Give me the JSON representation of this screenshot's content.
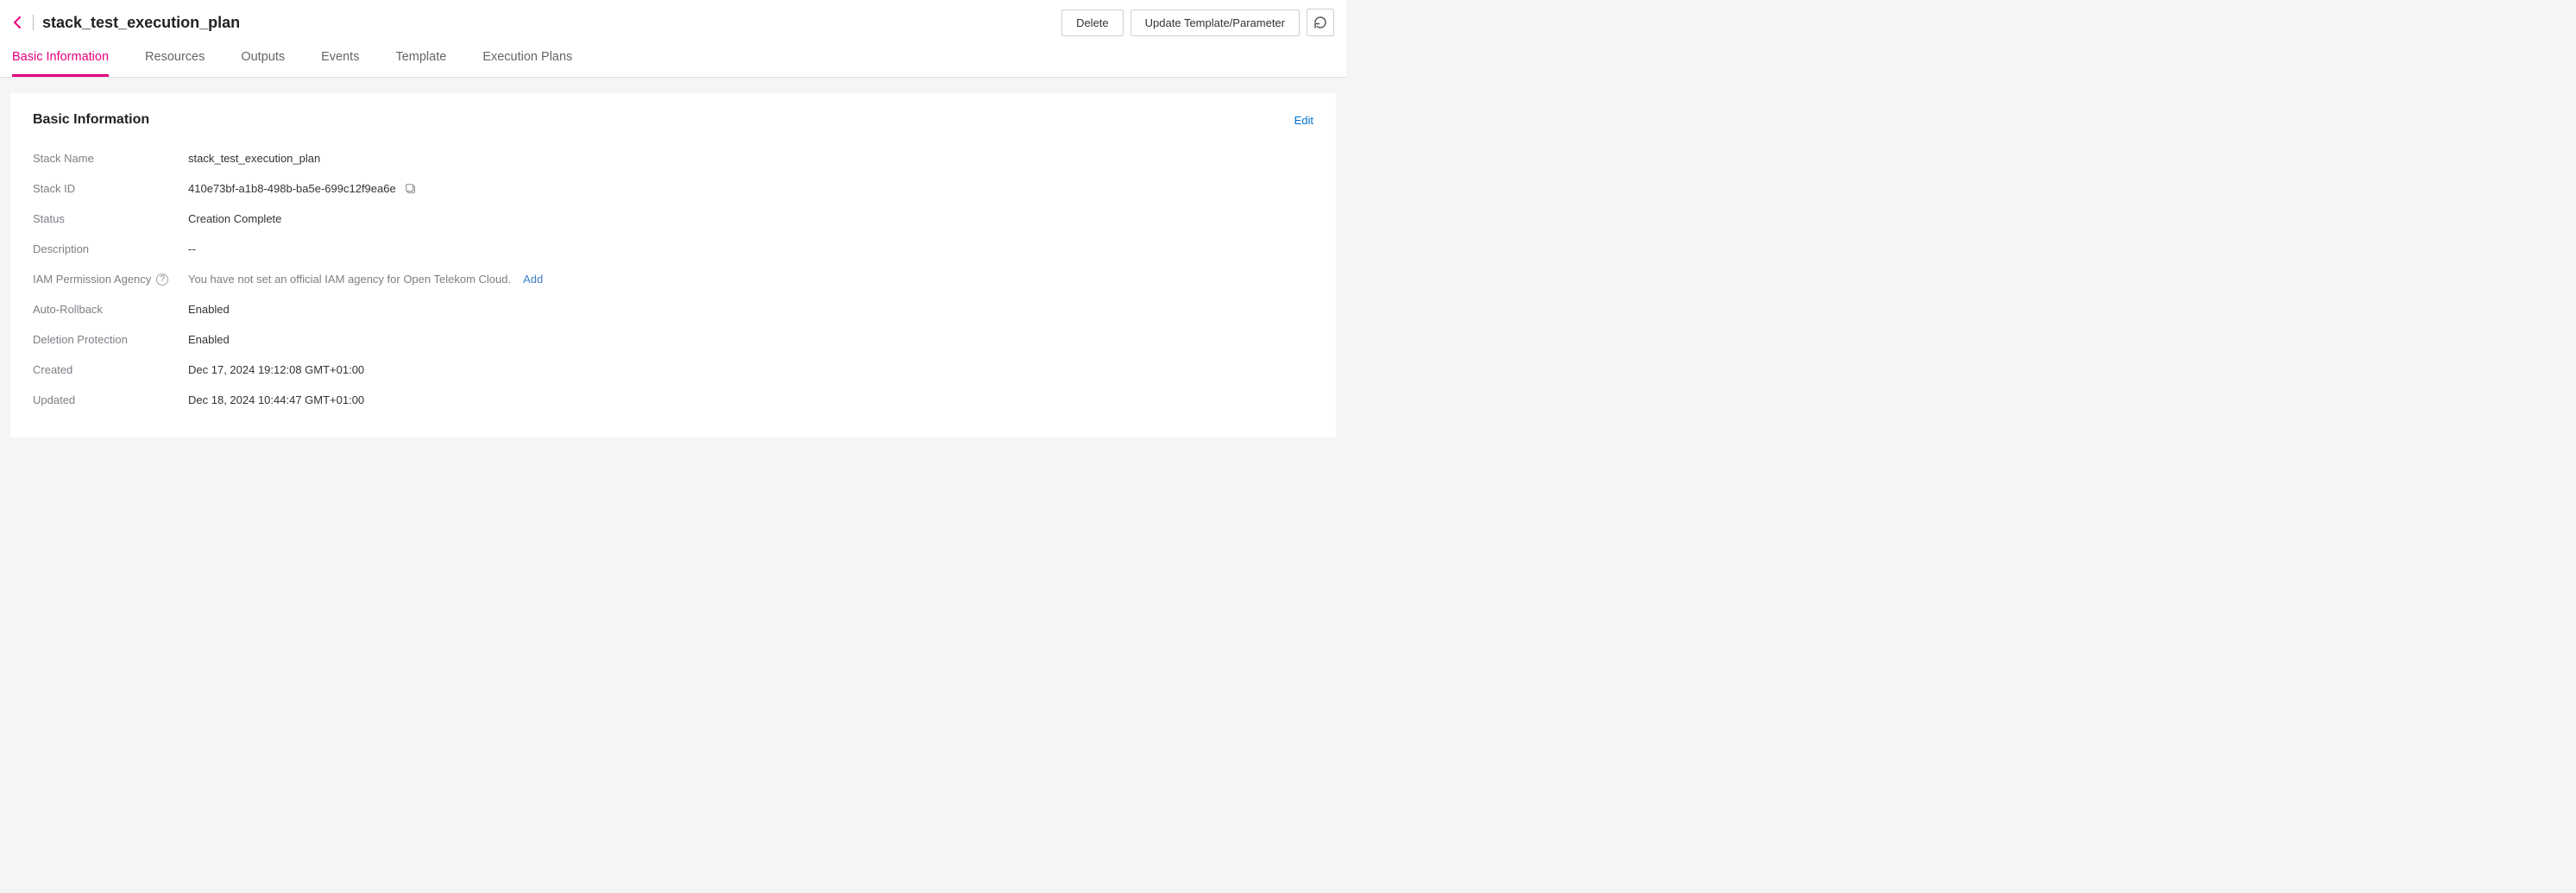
{
  "header": {
    "title": "stack_test_execution_plan",
    "actions": {
      "delete": "Delete",
      "update": "Update Template/Parameter"
    }
  },
  "tabs": [
    {
      "label": "Basic Information",
      "active": true
    },
    {
      "label": "Resources",
      "active": false
    },
    {
      "label": "Outputs",
      "active": false
    },
    {
      "label": "Events",
      "active": false
    },
    {
      "label": "Template",
      "active": false
    },
    {
      "label": "Execution Plans",
      "active": false
    }
  ],
  "card": {
    "title": "Basic Information",
    "edit": "Edit"
  },
  "fields": {
    "stackName": {
      "label": "Stack Name",
      "value": "stack_test_execution_plan"
    },
    "stackId": {
      "label": "Stack ID",
      "value": "410e73bf-a1b8-498b-ba5e-699c12f9ea6e"
    },
    "status": {
      "label": "Status",
      "value": "Creation Complete"
    },
    "description": {
      "label": "Description",
      "value": "--"
    },
    "iam": {
      "label": "IAM Permission Agency",
      "value": "You have not set an official IAM agency for Open Telekom Cloud.",
      "addLabel": "Add"
    },
    "autoRollback": {
      "label": "Auto-Rollback",
      "value": "Enabled"
    },
    "deletionProtection": {
      "label": "Deletion Protection",
      "value": "Enabled"
    },
    "created": {
      "label": "Created",
      "value": "Dec 17, 2024 19:12:08 GMT+01:00"
    },
    "updated": {
      "label": "Updated",
      "value": "Dec 18, 2024 10:44:47 GMT+01:00"
    }
  }
}
